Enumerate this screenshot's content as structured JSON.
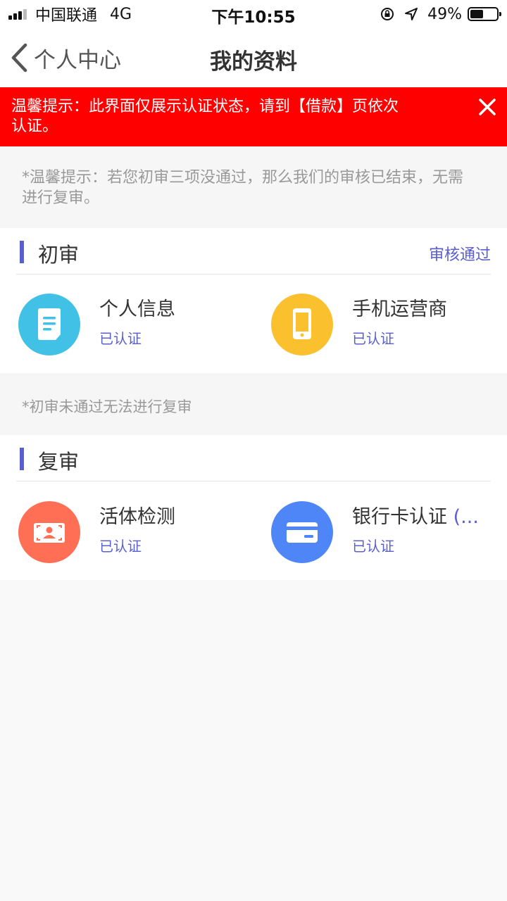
{
  "status_bar": {
    "carrier": "中国联通",
    "network": "4G",
    "time": "下午10:55",
    "battery_percent": "49%",
    "battery_level": 0.49
  },
  "nav": {
    "back_label": "个人中心",
    "title": "我的资料"
  },
  "notice": {
    "text": "温馨提示：此界面仅展示认证状态，请到【借款】页依次认证。",
    "color": "#fe0000"
  },
  "tip_top": "*温馨提示：若您初审三项没通过，那么我们的审核已结束，无需进行复审。",
  "initial_review": {
    "title": "初审",
    "status": "审核通过",
    "items": [
      {
        "title": "个人信息",
        "status": "已认证",
        "icon": "document-icon",
        "color": "#42c1e6"
      },
      {
        "title": "手机运营商",
        "status": "已认证",
        "icon": "phone-icon",
        "color": "#fbc02d"
      }
    ]
  },
  "tip_middle": "*初审未通过无法进行复审",
  "second_review": {
    "title": "复审",
    "items": [
      {
        "title": "活体检测",
        "status": "已认证",
        "icon": "face-scan-icon",
        "color": "#ff6f55"
      },
      {
        "title": "银行卡认证",
        "more": "(...",
        "status": "已认证",
        "icon": "bank-card-icon",
        "color": "#4e86f8"
      }
    ]
  },
  "accent_color": "#5a5fd0"
}
